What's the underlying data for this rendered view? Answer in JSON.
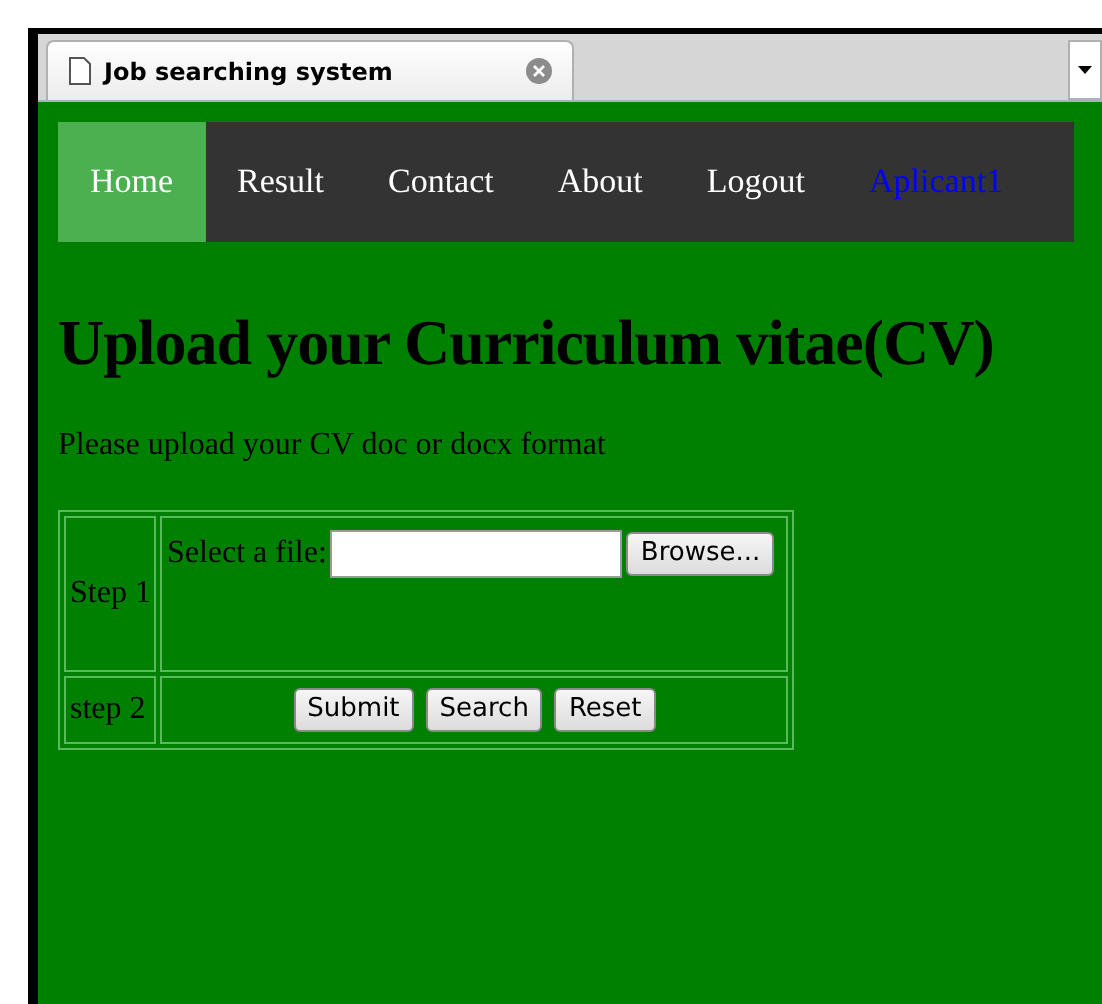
{
  "tab": {
    "title": "Job searching system"
  },
  "nav": [
    {
      "label": "Home",
      "selected": true,
      "kind": "link"
    },
    {
      "label": "Result",
      "selected": false,
      "kind": "link"
    },
    {
      "label": "Contact",
      "selected": false,
      "kind": "link"
    },
    {
      "label": "About",
      "selected": false,
      "kind": "link"
    },
    {
      "label": "Logout",
      "selected": false,
      "kind": "link"
    },
    {
      "label": "Aplicant1",
      "selected": false,
      "kind": "user"
    }
  ],
  "heading": "Upload your Curriculum vitae(CV)",
  "intro": "Please upload your CV doc or docx format",
  "steps": [
    {
      "label": "Step 1",
      "file_label": "Select a file:",
      "browse": "Browse..."
    },
    {
      "label": "step 2",
      "buttons": [
        "Submit",
        "Search",
        "Reset"
      ]
    }
  ]
}
